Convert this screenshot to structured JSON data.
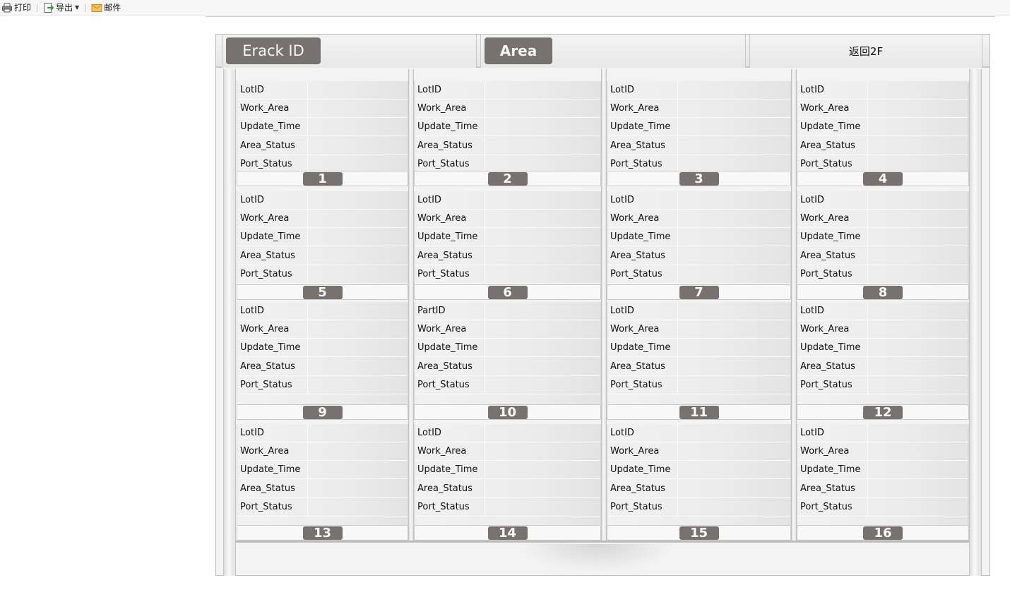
{
  "toolbar": {
    "print_label": "打印",
    "export_label": "导出",
    "mail_label": "邮件"
  },
  "header": {
    "erack_label": "Erack ID",
    "area_label": "Area",
    "back_label": "返回2F"
  },
  "slots": [
    {
      "number": "1",
      "fields": [
        "LotID",
        "Work_Area",
        "Update_Time",
        "Area_Status",
        "Port_Status"
      ]
    },
    {
      "number": "2",
      "fields": [
        "LotID",
        "Work_Area",
        "Update_Time",
        "Area_Status",
        "Port_Status"
      ]
    },
    {
      "number": "3",
      "fields": [
        "LotID",
        "Work_Area",
        "Update_Time",
        "Area_Status",
        "Port_Status"
      ]
    },
    {
      "number": "4",
      "fields": [
        "LotID",
        "Work_Area",
        "Update_Time",
        "Area_Status",
        "Port_Status"
      ]
    },
    {
      "number": "5",
      "fields": [
        "LotID",
        "Work_Area",
        "Update_Time",
        "Area_Status",
        "Port_Status"
      ]
    },
    {
      "number": "6",
      "fields": [
        "LotID",
        "Work_Area",
        "Update_Time",
        "Area_Status",
        "Port_Status"
      ]
    },
    {
      "number": "7",
      "fields": [
        "LotID",
        "Work_Area",
        "Update_Time",
        "Area_Status",
        "Port_Status"
      ]
    },
    {
      "number": "8",
      "fields": [
        "LotID",
        "Work_Area",
        "Update_Time",
        "Area_Status",
        "Port_Status"
      ]
    },
    {
      "number": "9",
      "fields": [
        "LotID",
        "Work_Area",
        "Update_Time",
        "Area_Status",
        "Port_Status"
      ]
    },
    {
      "number": "10",
      "fields": [
        "PartID",
        "Work_Area",
        "Update_Time",
        "Area_Status",
        "Port_Status"
      ]
    },
    {
      "number": "11",
      "fields": [
        "LotID",
        "Work_Area",
        "Update_Time",
        "Area_Status",
        "Port_Status"
      ]
    },
    {
      "number": "12",
      "fields": [
        "LotID",
        "Work_Area",
        "Update_Time",
        "Area_Status",
        "Port_Status"
      ]
    },
    {
      "number": "13",
      "fields": [
        "LotID",
        "Work_Area",
        "Update_Time",
        "Area_Status",
        "Port_Status"
      ]
    },
    {
      "number": "14",
      "fields": [
        "LotID",
        "Work_Area",
        "Update_Time",
        "Area_Status",
        "Port_Status"
      ]
    },
    {
      "number": "15",
      "fields": [
        "LotID",
        "Work_Area",
        "Update_Time",
        "Area_Status",
        "Port_Status"
      ]
    },
    {
      "number": "16",
      "fields": [
        "LotID",
        "Work_Area",
        "Update_Time",
        "Area_Status",
        "Port_Status"
      ]
    }
  ],
  "colors": {
    "badge": "#777170",
    "rack_bg": "#f3f3f3",
    "mail_icon": "#f0b040",
    "export_icon": "#3a9a3a"
  },
  "icons": {
    "print": "printer-icon",
    "export": "export-icon",
    "mail": "mail-icon"
  }
}
